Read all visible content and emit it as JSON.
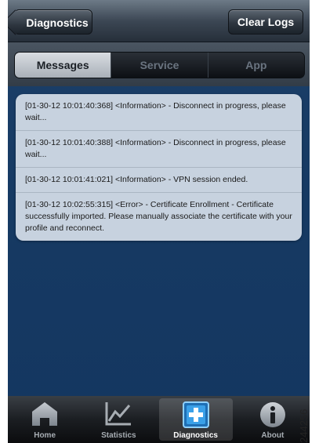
{
  "navbar": {
    "back_label": "Diagnostics",
    "clear_label": "Clear Logs"
  },
  "segments": [
    {
      "label": "Messages",
      "active": true
    },
    {
      "label": "Service",
      "active": false
    },
    {
      "label": "App",
      "active": false
    }
  ],
  "logs": [
    "[01-30-12 10:01:40:368] <Information> - Disconnect in progress, please wait...",
    "[01-30-12 10:01:40:388] <Information> - Disconnect in progress, please wait...",
    "[01-30-12 10:01:41:021] <Information> - VPN session ended.",
    "[01-30-12 10:02:55:315] <Error> - Certificate Enrollment - Certificate successfully imported. Please manually associate the certificate with your profile and reconnect."
  ],
  "tabs": [
    {
      "label": "Home",
      "icon": "home-icon",
      "active": false
    },
    {
      "label": "Statistics",
      "icon": "statistics-icon",
      "active": false
    },
    {
      "label": "Diagnostics",
      "icon": "diagnostics-icon",
      "active": true
    },
    {
      "label": "About",
      "icon": "info-icon",
      "active": false
    }
  ],
  "figure_number": "244256",
  "colors": {
    "background": "#163a63",
    "log_panel": "#d5dee8",
    "diagnostics_icon": "#3aa0e8"
  }
}
